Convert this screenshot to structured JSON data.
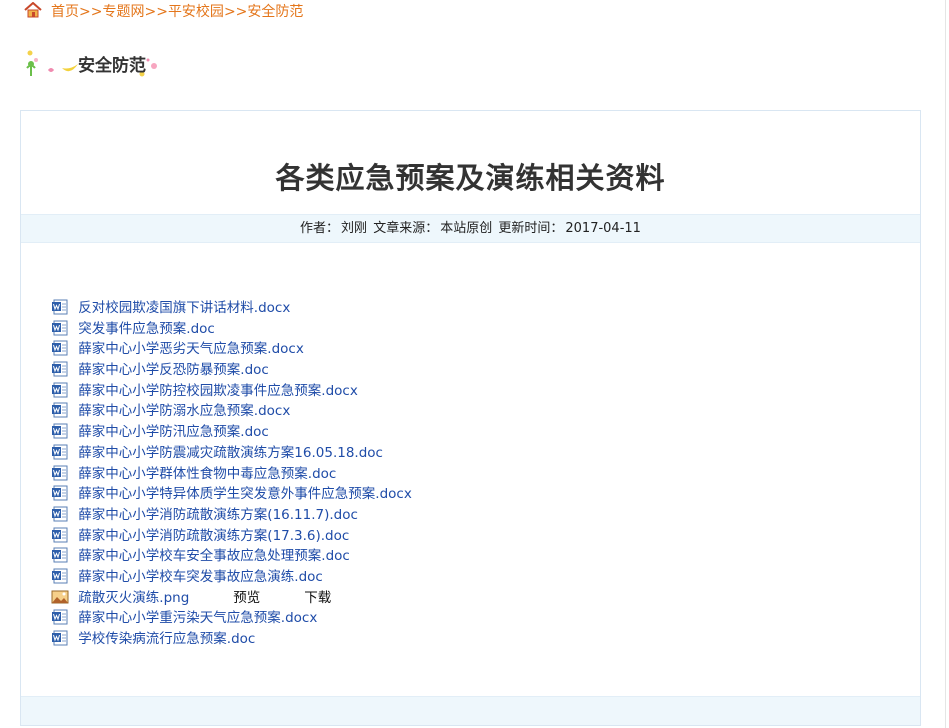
{
  "breadcrumb": {
    "items": [
      "首页",
      "专题网",
      "平安校园",
      "安全防范"
    ],
    "separator": ">>"
  },
  "section": {
    "title": "安全防范"
  },
  "article": {
    "title": "各类应急预案及演练相关资料",
    "meta": {
      "author_label": "作者：",
      "author": "刘刚",
      "source_label": "文章来源：",
      "source": "本站原创",
      "updated_label": "更新时间：",
      "updated": "2017-04-11"
    }
  },
  "attachments": [
    {
      "name": "反对校园欺凌国旗下讲话材料.docx",
      "icon": "word-doc-icon"
    },
    {
      "name": "突发事件应急预案.doc",
      "icon": "word-doc-icon"
    },
    {
      "name": "薛家中心小学恶劣天气应急预案.docx",
      "icon": "word-doc-icon"
    },
    {
      "name": "薛家中心小学反恐防暴预案.doc",
      "icon": "word-doc-icon"
    },
    {
      "name": "薛家中心小学防控校园欺凌事件应急预案.docx",
      "icon": "word-doc-icon"
    },
    {
      "name": "薛家中心小学防溺水应急预案.docx",
      "icon": "word-doc-icon"
    },
    {
      "name": "薛家中心小学防汛应急预案.doc",
      "icon": "word-doc-icon"
    },
    {
      "name": "薛家中心小学防震减灾疏散演练方案16.05.18.doc",
      "icon": "word-doc-icon"
    },
    {
      "name": "薛家中心小学群体性食物中毒应急预案.doc",
      "icon": "word-doc-icon"
    },
    {
      "name": "薛家中心小学特异体质学生突发意外事件应急预案.docx",
      "icon": "word-doc-icon"
    },
    {
      "name": "薛家中心小学消防疏散演练方案(16.11.7).doc",
      "icon": "word-doc-icon"
    },
    {
      "name": "薛家中心小学消防疏散演练方案(17.3.6).doc",
      "icon": "word-doc-icon"
    },
    {
      "name": "薛家中心小学校车安全事故应急处理预案.doc",
      "icon": "word-doc-icon"
    },
    {
      "name": "薛家中心小学校车突发事故应急演练.doc",
      "icon": "word-doc-icon"
    },
    {
      "name": "疏散灭火演练.png",
      "icon": "image-file-icon",
      "preview": "预览",
      "download": "下载"
    },
    {
      "name": "薛家中心小学重污染天气应急预案.docx",
      "icon": "word-doc-icon"
    },
    {
      "name": "学校传染病流行应急预案.doc",
      "icon": "word-doc-icon"
    }
  ]
}
